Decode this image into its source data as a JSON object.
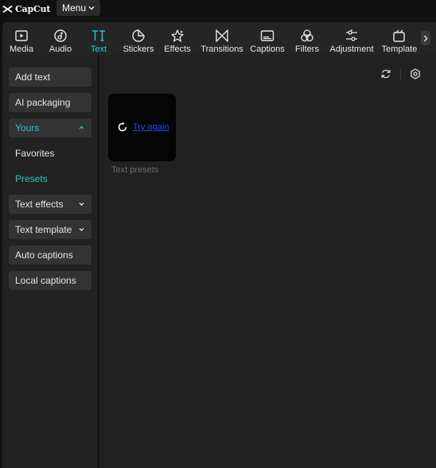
{
  "app": {
    "logo_text": "CapCut",
    "menu_label": "Menu"
  },
  "tabs": [
    {
      "label": "Media",
      "icon": "media-icon",
      "active": false
    },
    {
      "label": "Audio",
      "icon": "audio-icon",
      "active": false
    },
    {
      "label": "Text",
      "icon": "text-icon",
      "active": true
    },
    {
      "label": "Stickers",
      "icon": "stickers-icon",
      "active": false
    },
    {
      "label": "Effects",
      "icon": "effects-icon",
      "active": false
    },
    {
      "label": "Transitions",
      "icon": "transitions-icon",
      "active": false
    },
    {
      "label": "Captions",
      "icon": "captions-icon",
      "active": false
    },
    {
      "label": "Filters",
      "icon": "filters-icon",
      "active": false
    },
    {
      "label": "Adjustment",
      "icon": "adjustment-icon",
      "active": false
    },
    {
      "label": "Template",
      "icon": "templates-icon",
      "active": false
    }
  ],
  "sidebar": {
    "items": [
      {
        "label": "Add text"
      },
      {
        "label": "AI packaging"
      },
      {
        "label": "Yours",
        "expanded": true
      },
      {
        "label": "Favorites"
      },
      {
        "label": "Presets",
        "selected": true
      },
      {
        "label": "Text effects",
        "expanded": false
      },
      {
        "label": "Text template",
        "expanded": false
      },
      {
        "label": "Auto captions"
      },
      {
        "label": "Local captions"
      }
    ]
  },
  "main": {
    "card": {
      "retry_label": "Try again",
      "caption": "Text presets"
    }
  },
  "colors": {
    "accent": "#22c7d6",
    "background": "#101010",
    "panel": "#222222",
    "link": "#2a43ff"
  }
}
